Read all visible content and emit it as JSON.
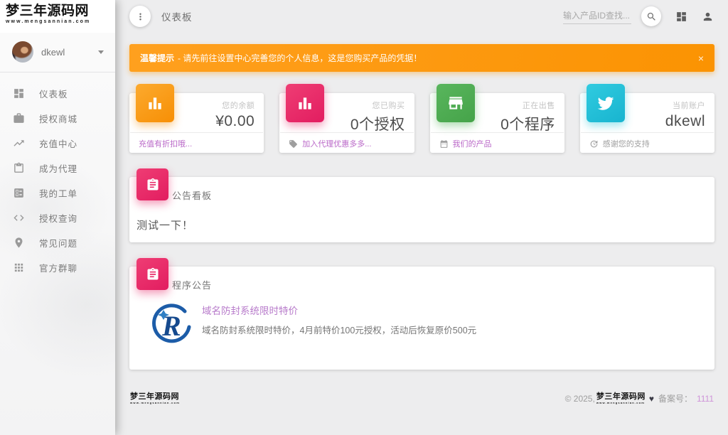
{
  "brand": {
    "name": "梦三年源码网",
    "domain": "www.mengsannian.com"
  },
  "sidebar": {
    "user": {
      "name": "dkewl"
    },
    "items": [
      {
        "label": "仪表板",
        "icon": "dashboard-icon"
      },
      {
        "label": "授权商城",
        "icon": "briefcase-icon"
      },
      {
        "label": "充值中心",
        "icon": "trending-up-icon"
      },
      {
        "label": "成为代理",
        "icon": "clipboard-icon"
      },
      {
        "label": "我的工单",
        "icon": "ballot-icon"
      },
      {
        "label": "授权查询",
        "icon": "code-icon"
      },
      {
        "label": "常见问题",
        "icon": "location-pin-icon"
      },
      {
        "label": "官方群聊",
        "icon": "apps-grid-icon"
      }
    ]
  },
  "header": {
    "title": "仪表板",
    "search_placeholder": "输入产品ID查找..."
  },
  "alert": {
    "bold": "温馨提示",
    "text": "- 请先前往设置中心完善您的个人信息，这是您购买产品的凭据！",
    "close": "×",
    "color": "#fb9302"
  },
  "stats": [
    {
      "label": "您的余额",
      "value": "¥0.00",
      "footer": "充值有折扣哦...",
      "icon": "bar-chart-icon",
      "color": "#f78f05"
    },
    {
      "label": "您已购买",
      "value": "0个授权",
      "footer": "加入代理优惠多多...",
      "icon": "bar-chart-icon",
      "footer_icon": "tag-icon",
      "color": "#e6245f"
    },
    {
      "label": "正在出售",
      "value": "0个程序",
      "footer": "我们的产品",
      "icon": "storefront-icon",
      "footer_icon": "calendar-icon",
      "color": "#4caf50"
    },
    {
      "label": "当前账户",
      "value": "dkewl",
      "footer": "感谢您的支持",
      "icon": "twitter-icon",
      "footer_icon": "update-icon",
      "color": "#23c1da"
    }
  ],
  "board": {
    "title": "公告看板",
    "content": "测试一下！"
  },
  "announcement": {
    "title": "程序公告",
    "item": {
      "link": "域名防封系统限时特价",
      "desc": "域名防封系统限时特价，4月前特价100元授权，活动后恢复原价500元"
    }
  },
  "footer": {
    "copyright": "© 2025,",
    "heart": "♥",
    "beian_label": "备案号：",
    "beian_value": "1111"
  },
  "colors": {
    "link_purple": "#ba68c8",
    "beian_pink": "#ce93d8",
    "alert_orange": "#fb9302"
  }
}
